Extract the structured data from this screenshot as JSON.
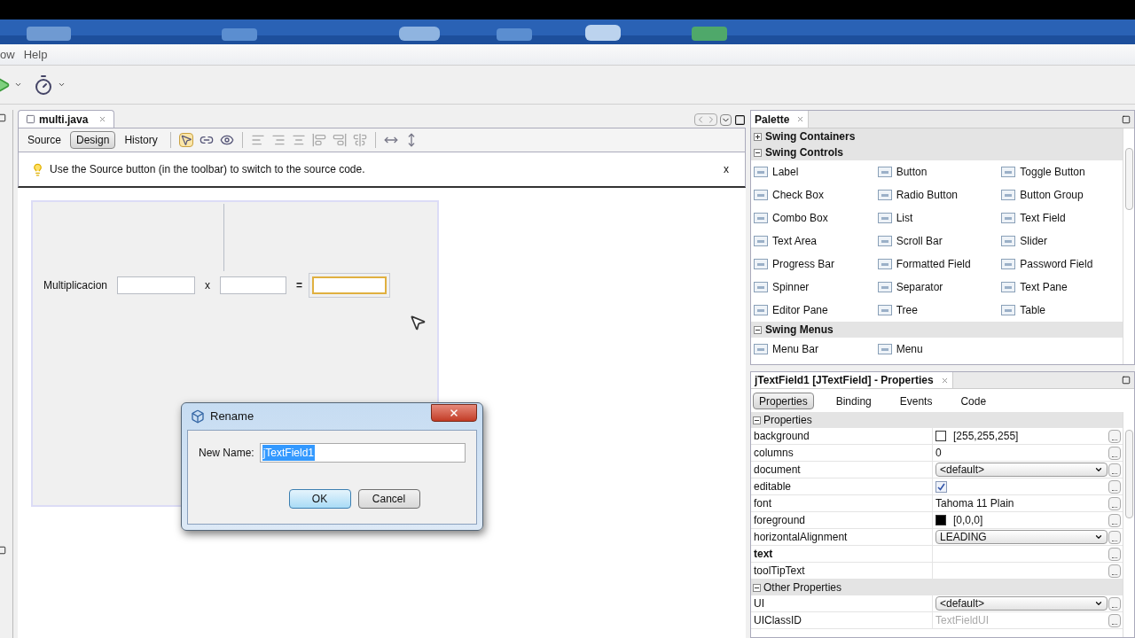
{
  "menu": [
    "ow",
    "Help"
  ],
  "editor": {
    "tab": "multi.java",
    "view_tabs": [
      {
        "label": "Source",
        "selected": false
      },
      {
        "label": "Design",
        "selected": true
      },
      {
        "label": "History",
        "selected": false
      }
    ],
    "hint": "Use the Source button (in the toolbar) to switch to the source code.",
    "hint_close": "x",
    "form": {
      "label": "Multiplicacion",
      "operator": "x",
      "equals": "=",
      "fields": [
        {
          "selected": false
        },
        {
          "selected": false
        },
        {
          "selected": true
        }
      ]
    }
  },
  "dialog": {
    "title": "Rename",
    "field_label": "New Name:",
    "value": "jTextField1",
    "buttons": [
      {
        "label": "OK",
        "default": true
      },
      {
        "label": "Cancel",
        "default": false
      }
    ]
  },
  "palette": {
    "title": "Palette",
    "categories": [
      {
        "name": "Swing Containers",
        "expanded": false
      },
      {
        "name": "Swing Controls",
        "expanded": true,
        "items": [
          "Label",
          "Button",
          "Toggle Button",
          "Check Box",
          "Radio Button",
          "Button Group",
          "Combo Box",
          "List",
          "Text Field",
          "Text Area",
          "Scroll Bar",
          "Slider",
          "Progress Bar",
          "Formatted Field",
          "Password Field",
          "Spinner",
          "Separator",
          "Text Pane",
          "Editor Pane",
          "Tree",
          "Table"
        ]
      },
      {
        "name": "Swing Menus",
        "expanded": true,
        "items": [
          "Menu Bar",
          "Menu"
        ]
      }
    ]
  },
  "properties": {
    "title": "jTextField1 [JTextField] - Properties",
    "tabs": [
      {
        "label": "Properties",
        "selected": true
      },
      {
        "label": "Binding",
        "selected": false
      },
      {
        "label": "Events",
        "selected": false
      },
      {
        "label": "Code",
        "selected": false
      }
    ],
    "sections": [
      {
        "name": "Properties",
        "expanded": true,
        "rows": [
          {
            "name": "background",
            "kind": "color",
            "color": "#ffffff",
            "value": "[255,255,255]"
          },
          {
            "name": "columns",
            "kind": "text",
            "value": "0"
          },
          {
            "name": "document",
            "kind": "combo",
            "value": "<default>"
          },
          {
            "name": "editable",
            "kind": "check",
            "checked": true
          },
          {
            "name": "font",
            "kind": "text",
            "value": "Tahoma 11 Plain"
          },
          {
            "name": "foreground",
            "kind": "color",
            "color": "#000000",
            "value": "[0,0,0]"
          },
          {
            "name": "horizontalAlignment",
            "kind": "combo",
            "value": "LEADING"
          },
          {
            "name": "text",
            "kind": "text",
            "bold": true
          },
          {
            "name": "toolTipText",
            "kind": "text"
          }
        ]
      },
      {
        "name": "Other Properties",
        "expanded": true,
        "rows": [
          {
            "name": "UI",
            "kind": "combo",
            "value": "<default>"
          },
          {
            "name": "UIClassID",
            "kind": "text",
            "value": "TextFieldUI",
            "disabled": true
          }
        ]
      }
    ]
  }
}
